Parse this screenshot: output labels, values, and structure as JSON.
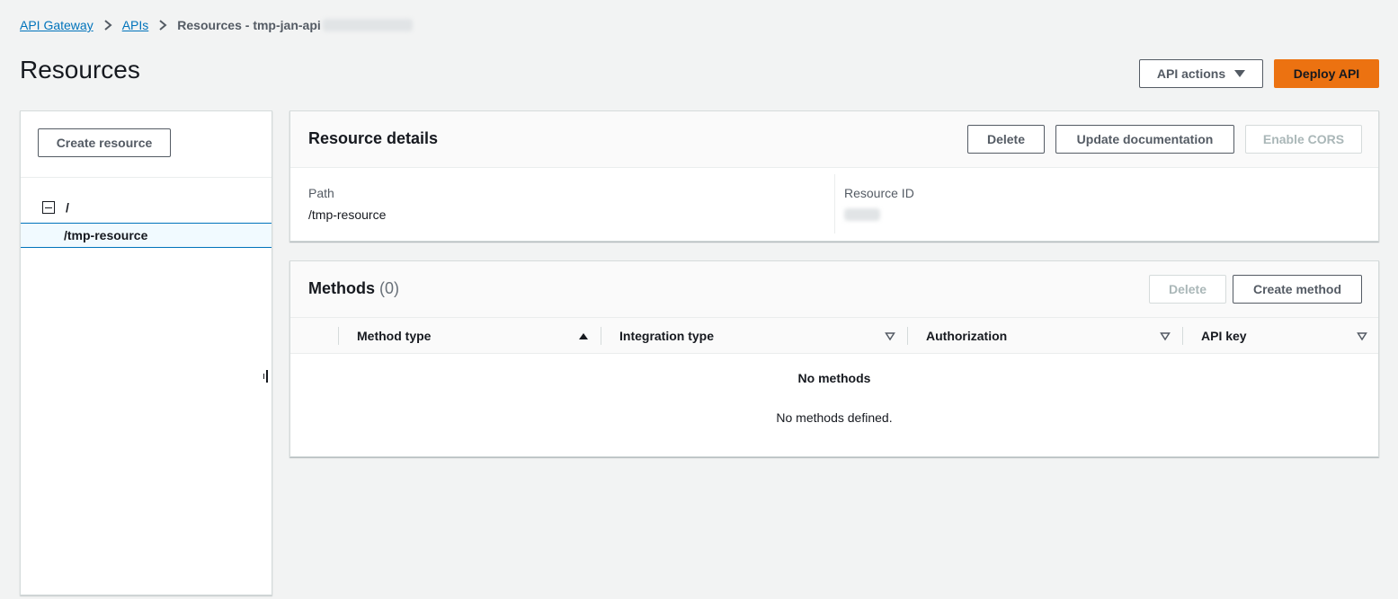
{
  "breadcrumb": {
    "items": [
      "API Gateway",
      "APIs"
    ],
    "current": "Resources - tmp-jan-api"
  },
  "page": {
    "title": "Resources"
  },
  "header_actions": {
    "api_actions_label": "API actions",
    "deploy_label": "Deploy API"
  },
  "resource_tree": {
    "create_label": "Create resource",
    "root": "/",
    "items": [
      "/tmp-resource"
    ]
  },
  "resource_details": {
    "title": "Resource details",
    "delete_label": "Delete",
    "update_doc_label": "Update documentation",
    "enable_cors_label": "Enable CORS",
    "path_label": "Path",
    "path_value": "/tmp-resource",
    "resource_id_label": "Resource ID"
  },
  "methods": {
    "title": "Methods",
    "count": "(0)",
    "delete_label": "Delete",
    "create_label": "Create method",
    "columns": [
      "Method type",
      "Integration type",
      "Authorization",
      "API key"
    ],
    "empty_title": "No methods",
    "empty_text": "No methods defined."
  },
  "colors": {
    "primary": "#ec7211",
    "link": "#0073bb",
    "selected_bg": "#f1faff"
  }
}
